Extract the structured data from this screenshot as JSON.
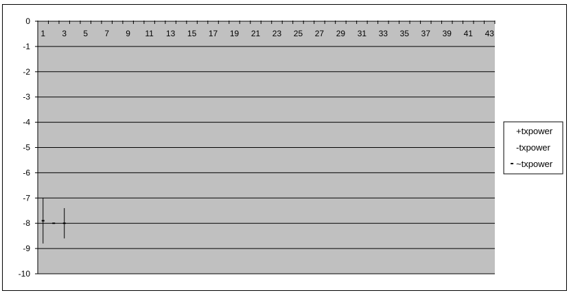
{
  "chart_data": {
    "type": "stock",
    "title": "",
    "xlabel": "",
    "ylabel": "",
    "categories": [
      1,
      2,
      3,
      4,
      5,
      6,
      7,
      8,
      9,
      10,
      11,
      12,
      13,
      14,
      15,
      16,
      17,
      18,
      19,
      20,
      21,
      22,
      23,
      24,
      25,
      26,
      27,
      28,
      29,
      30,
      31,
      32,
      33,
      34,
      35,
      36,
      37,
      38,
      39,
      40,
      41,
      42,
      43
    ],
    "x_tick_labels": [
      "1",
      "3",
      "5",
      "7",
      "9",
      "11",
      "13",
      "15",
      "17",
      "19",
      "21",
      "23",
      "25",
      "27",
      "29",
      "31",
      "33",
      "35",
      "37",
      "39",
      "41",
      "43"
    ],
    "y_tick_labels": [
      "0",
      "-1",
      "-2",
      "-3",
      "-4",
      "-5",
      "-6",
      "-7",
      "-8",
      "-9",
      "-10"
    ],
    "ylim": [
      -10,
      0
    ],
    "x_axis_position": "top",
    "grid": true,
    "plot_background": "#c0c0c0",
    "series": [
      {
        "name": "+txpower",
        "values": [
          -7.0,
          null,
          -7.4
        ]
      },
      {
        "name": "-txpower",
        "values": [
          -8.8,
          null,
          -8.6
        ]
      },
      {
        "name": "~txpower",
        "values": [
          -7.9,
          -8.0,
          -8.0
        ]
      }
    ],
    "legend": {
      "position": "right",
      "entries": [
        "+txpower",
        "-txpower",
        "~txpower"
      ]
    }
  }
}
